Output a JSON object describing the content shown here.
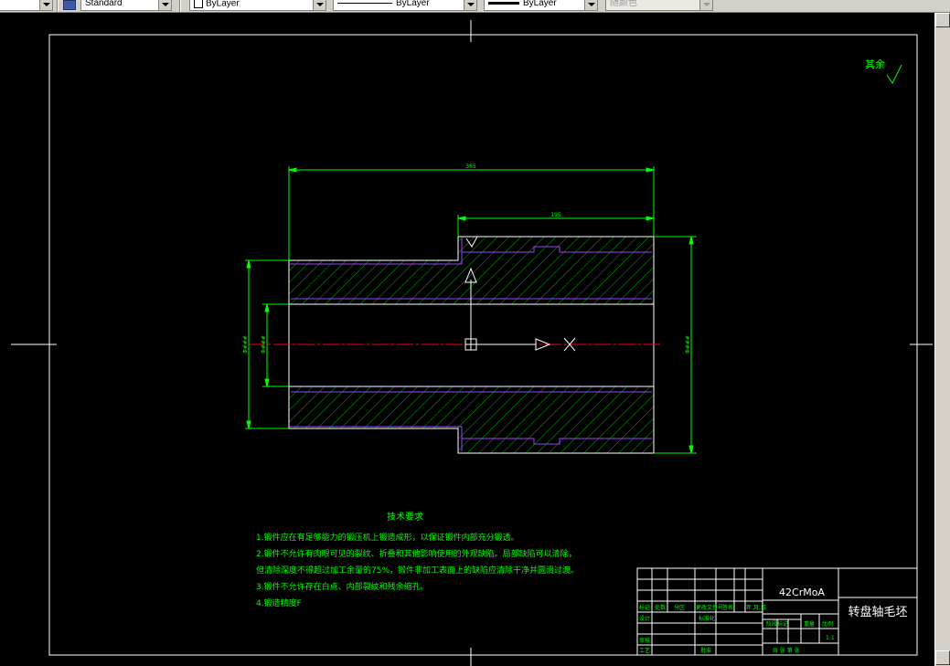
{
  "toolbar": {
    "text_style": "Standard",
    "layer": "ByLayer",
    "linetype": "ByLayer",
    "lineweight": "ByLayer",
    "plot_style": "随颜色"
  },
  "drawing": {
    "roughness_note": "其余",
    "dim_overall_length": "365",
    "dim_step_length": "195",
    "dim_left_outer_dia": "Φ###",
    "dim_bore_dia": "Φ###",
    "dim_right_outer_dia": "Φ###",
    "tech_title": "技术要求",
    "tech_lines": [
      "1.锻件应在有足够能力的锻压机上锻造成形，以保证锻件内部充分锻透。",
      "2.锻件不允许有肉眼可见的裂纹、折叠和其他影响使用的外观缺陷。局部缺陷可以清除，",
      "但清除深度不得超过加工余量的75%，锻件非加工表面上的缺陷应清除干净并圆滑过渡。",
      "3.锻件不允许存在白点、内部裂纹和残余缩孔。",
      "4.锻造精度F"
    ],
    "title_block": {
      "material": "42CrMoA",
      "part_name": "转盘轴毛坯",
      "scale": "1:1",
      "row_headers": [
        "标记",
        "处数",
        "分区",
        "更改文件号",
        "签名",
        "年.月.日"
      ],
      "design": "设计",
      "standardization": "标准化",
      "review": "审核",
      "process": "工艺",
      "approve": "批准",
      "stage_mark": "阶段标记",
      "weight": "重量",
      "scale_label": "比例",
      "sheets": "共 张 第 张"
    }
  },
  "colors": {
    "background": "#000000",
    "frame": "#ffffff",
    "dimension": "#00ff00",
    "text": "#00ff00",
    "hatch": "#00ff00",
    "hidden": "#a040ff",
    "centerline": "#ff0000"
  }
}
